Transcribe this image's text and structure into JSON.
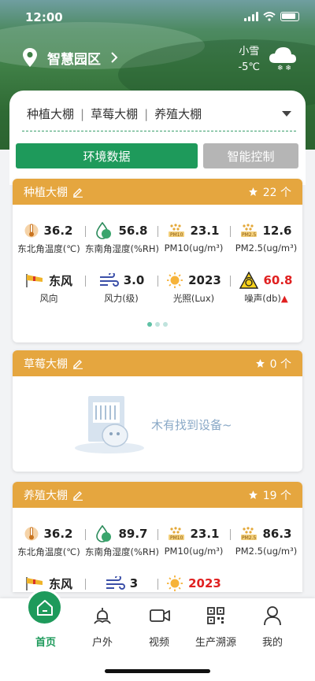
{
  "status": {
    "time": "12:00"
  },
  "location": {
    "name": "智慧园区"
  },
  "weather": {
    "condition": "小雪",
    "temp": "-5℃"
  },
  "tabs": [
    "种植大棚",
    "草莓大棚",
    "养殖大棚"
  ],
  "segments": {
    "env": "环境数据",
    "ctrl": "智能控制"
  },
  "panels": [
    {
      "title": "种植大棚",
      "count": "22 个",
      "row1": [
        {
          "val": "36.2",
          "lbl": "东北角温度(℃)",
          "icon": "thermometer-icon"
        },
        {
          "val": "56.8",
          "lbl": "东南角湿度(%RH)",
          "icon": "humidity-icon"
        },
        {
          "val": "23.1",
          "lbl": "PM10(ug/m³)",
          "icon": "pm10-icon"
        },
        {
          "val": "12.6",
          "lbl": "PM2.5(ug/m³)",
          "icon": "pm25-icon"
        }
      ],
      "row2": [
        {
          "val": "东风",
          "lbl": "风向",
          "icon": "wind-flag-icon"
        },
        {
          "val": "3.0",
          "lbl": "风力(级)",
          "icon": "wind-icon"
        },
        {
          "val": "2023",
          "lbl": "光照(Lux)",
          "icon": "sun-icon"
        },
        {
          "val": "60.8",
          "lbl": "噪声(db)",
          "icon": "noise-icon"
        }
      ]
    },
    {
      "title": "草莓大棚",
      "count": "0 个",
      "empty": "木有找到设备~"
    },
    {
      "title": "养殖大棚",
      "count": "19 个",
      "row1": [
        {
          "val": "36.2",
          "lbl": "东北角温度(℃)",
          "icon": "thermometer-icon"
        },
        {
          "val": "89.7",
          "lbl": "东南角湿度(%RH)",
          "icon": "humidity-icon"
        },
        {
          "val": "23.1",
          "lbl": "PM10(ug/m³)",
          "icon": "pm10-icon"
        },
        {
          "val": "86.3",
          "lbl": "PM2.5(ug/m³)",
          "icon": "pm25-icon"
        }
      ],
      "row2": [
        {
          "val": "东风",
          "icon": "wind-flag-icon"
        },
        {
          "val": "3",
          "icon": "wind-icon"
        },
        {
          "val": "2023",
          "icon": "sun-icon"
        }
      ]
    }
  ],
  "nav": [
    "首页",
    "户外",
    "视频",
    "生产溯源",
    "我的"
  ],
  "colors": {
    "primary": "#1e9a5b",
    "header": "#e5a63f",
    "alert": "#e02020"
  }
}
